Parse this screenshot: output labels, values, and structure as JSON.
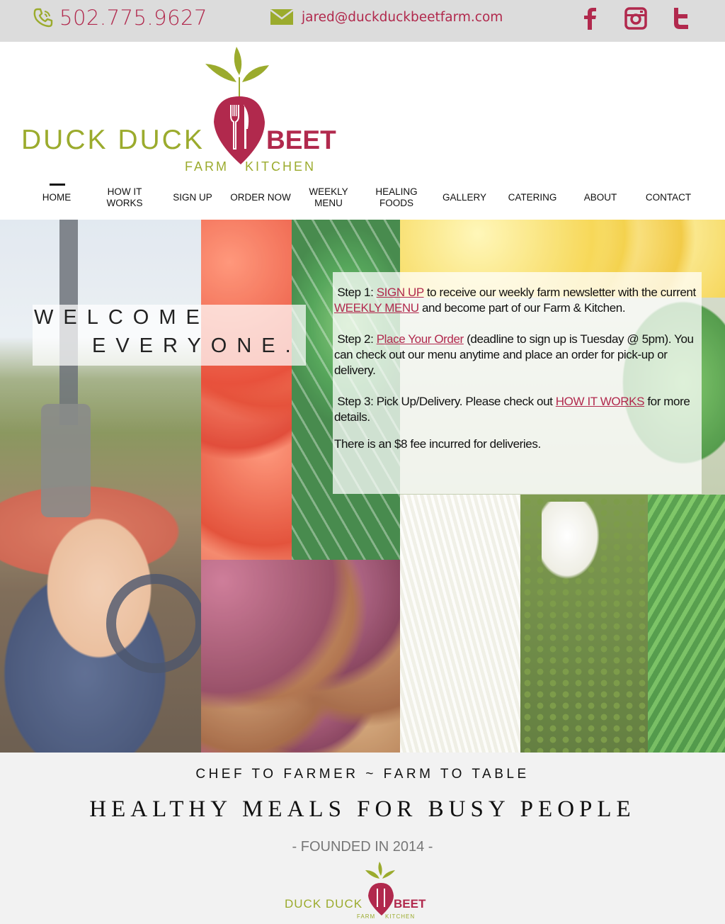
{
  "topbar": {
    "phone": "502.775.9627",
    "email": "jared@duckduckbeetfarm.com",
    "icons": [
      "phone-icon",
      "mail-icon",
      "facebook-icon",
      "instagram-icon",
      "twitter-icon"
    ]
  },
  "logo": {
    "left_text": "DUCK DUCK",
    "right_text": "BEET",
    "sub_left": "FARM",
    "sub_right": "KITCHEN"
  },
  "nav": {
    "items": [
      {
        "label": "HOME",
        "active": true
      },
      {
        "label": "HOW IT WORKS"
      },
      {
        "label": "SIGN UP"
      },
      {
        "label": "ORDER NOW"
      },
      {
        "label": "WEEKLY MENU"
      },
      {
        "label": "HEALING FOODS"
      },
      {
        "label": "GALLERY"
      },
      {
        "label": "CATERING"
      },
      {
        "label": "ABOUT"
      },
      {
        "label": "CONTACT"
      }
    ]
  },
  "hero": {
    "welcome_line1": "WELCOME",
    "welcome_line2": "EVERYONE.",
    "step1": {
      "prefix": "Step 1: ",
      "link1": "SIGN UP",
      "mid": " to receive our weekly farm newsletter with the current ",
      "link2": "WEEKLY MENU",
      "suffix": " and become part of our Farm & Kitchen."
    },
    "step2": {
      "prefix": "Step 2: ",
      "link": "Place Your Order",
      "suffix": " (deadline to sign up is Tuesday @ 5pm). You can check out our menu anytime and place an order for pick-up or delivery."
    },
    "step3": {
      "prefix": "Step 3: Pick Up/Delivery. Please check out ",
      "link": "HOW IT WORKS",
      "suffix": " for more details."
    },
    "fee": "There is an $8 fee incurred for deliveries."
  },
  "band": {
    "tagline": "CHEF TO FARMER ~ FARM TO TABLE",
    "headline": "HEALTHY MEALS FOR BUSY PEOPLE",
    "founded": "- FOUNDED IN 2014 -"
  },
  "colors": {
    "brand_red": "#b1294d",
    "brand_green": "#9bab2d",
    "topbar_bg": "#dcdcdc",
    "band_bg": "#f2f2f2"
  }
}
